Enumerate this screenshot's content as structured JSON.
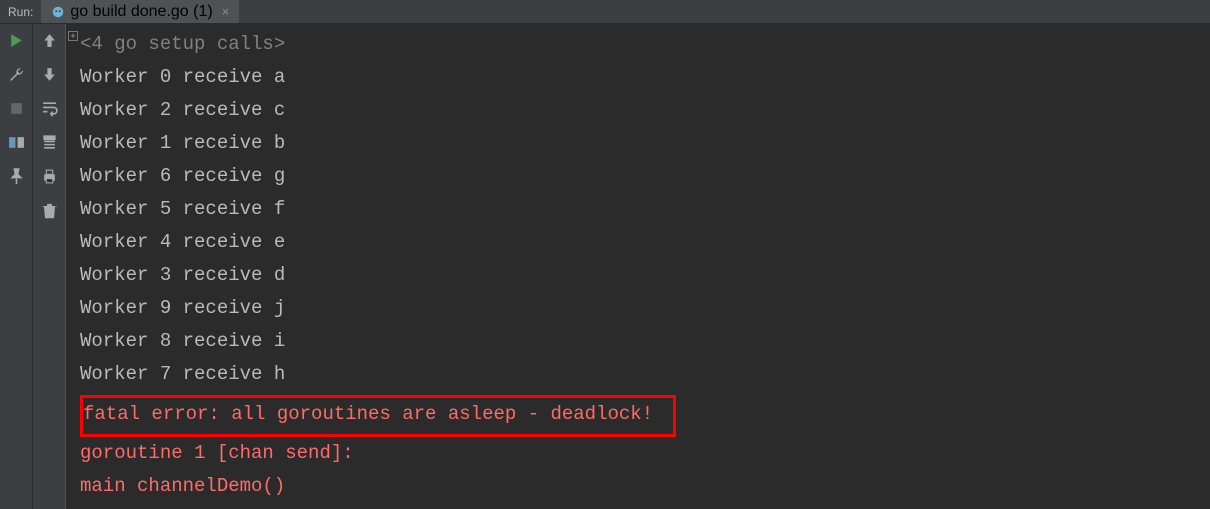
{
  "header": {
    "panel_label": "Run:",
    "tab_title": "go build done.go (1)"
  },
  "console": {
    "folded": "<4 go setup calls>",
    "lines": [
      "Worker 0 receive a",
      "Worker 2 receive c",
      "Worker 1 receive b",
      "Worker 6 receive g",
      "Worker 5 receive f",
      "Worker 4 receive e",
      "Worker 3 receive d",
      "Worker 9 receive j",
      "Worker 8 receive i",
      "Worker 7 receive h"
    ],
    "error_highlight": "fatal error: all goroutines are asleep - deadlock!",
    "trailing": [
      "",
      "goroutine 1 [chan send]:",
      "main channelDemo()"
    ]
  }
}
